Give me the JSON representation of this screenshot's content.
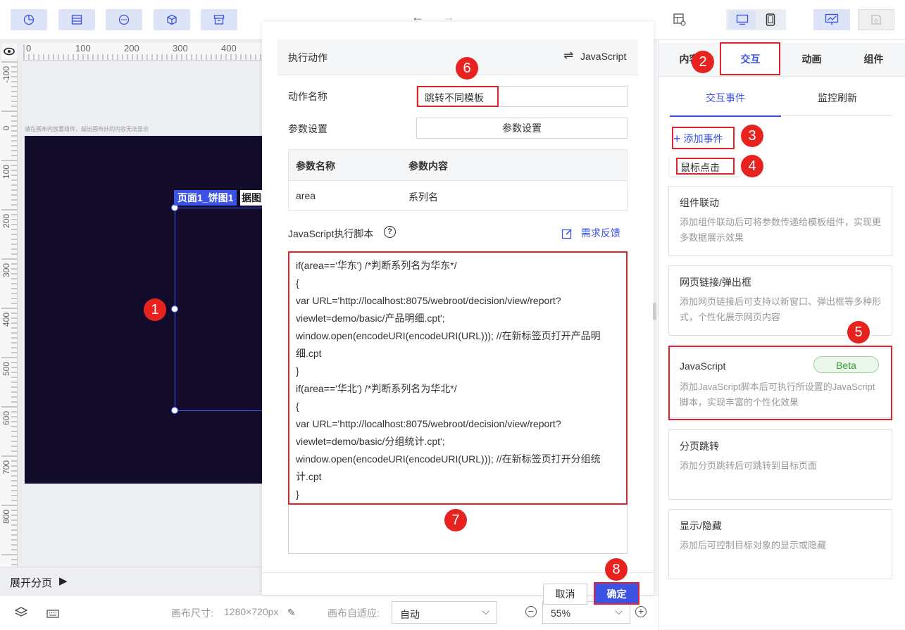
{
  "toolbar": {
    "left_icons": [
      "pie-chart-icon",
      "table-icon",
      "more-icon",
      "cube-icon",
      "archive-icon"
    ],
    "right_icons": [
      "settings-grid-icon",
      "desktop-icon",
      "mobile-icon",
      "preview-icon",
      "save-icon"
    ]
  },
  "canvas": {
    "ruler_h": [
      "0",
      "100",
      "200",
      "300",
      "400"
    ],
    "ruler_v": [
      "-100",
      "0",
      "100",
      "200",
      "300",
      "400",
      "500",
      "600",
      "700",
      "800"
    ],
    "hint": "请在画布内放置组件，超出画布外的内容无法显示",
    "component_label": "页面1_饼图1",
    "partial_text": "据图",
    "expand_pages": "展开分页"
  },
  "footer": {
    "canvas_size_label": "画布尺寸:",
    "canvas_size_value": "1280×720px",
    "adapt_label": "画布自适应:",
    "adapt_value": "自动",
    "zoom_value": "55%"
  },
  "dialog": {
    "title": "执行动作",
    "type_label": "JavaScript",
    "action_name_label": "动作名称",
    "action_name_value": "跳转不同模板",
    "param_label": "参数设置",
    "param_button": "参数设置",
    "table_headers": [
      "参数名称",
      "参数内容"
    ],
    "table_rows": [
      [
        "area",
        "系列名"
      ]
    ],
    "script_label": "JavaScript执行脚本",
    "feedback_label": "需求反馈",
    "code_lines": [
      "if(area=='华东') /*判断系列名为华东*/",
      "{",
      "var URL='http://localhost:8075/webroot/decision/view/report?",
      "viewlet=demo/basic/产品明细.cpt';",
      "window.open(encodeURI(encodeURI(URL))); //在新标签页打开产品明",
      "细.cpt",
      "}",
      "if(area=='华北') /*判断系列名为华北*/",
      "{",
      "var URL='http://localhost:8075/webroot/decision/view/report?",
      "viewlet=demo/basic/分组统计.cpt';",
      "window.open(encodeURI(encodeURI(URL))); //在新标签页打开分组统",
      "计.cpt",
      "}"
    ],
    "cancel": "取消",
    "confirm": "确定"
  },
  "right_panel": {
    "tabs": [
      "内容",
      "交互",
      "动画",
      "组件"
    ],
    "subtabs": [
      "交互事件",
      "监控刷新"
    ],
    "add_event": "添加事件",
    "mouse_click": "鼠标点击",
    "cards": [
      {
        "title": "组件联动",
        "desc": "添加组件联动后可将参数传递给模板组件，实现更多数据展示效果"
      },
      {
        "title": "网页链接/弹出框",
        "desc": "添加网页链接后可支持以新窗口、弹出框等多种形式，个性化展示网页内容"
      },
      {
        "title": "JavaScript",
        "badge": "Beta",
        "desc": "添加JavaScript脚本后可执行所设置的JavaScript脚本，实现丰富的个性化效果"
      },
      {
        "title": "分页跳转",
        "desc": "添加分页跳转后可跳转到目标页面"
      },
      {
        "title": "显示/隐藏",
        "desc": "添加后可控制目标对象的显示或隐藏"
      }
    ]
  },
  "badges": [
    "1",
    "2",
    "3",
    "4",
    "5",
    "6",
    "7",
    "8"
  ],
  "colors": {
    "accent": "#3b52e4",
    "highlight": "#e0232c",
    "canvas_bg": "#120c2a",
    "badge_green": "#5cb85c"
  }
}
